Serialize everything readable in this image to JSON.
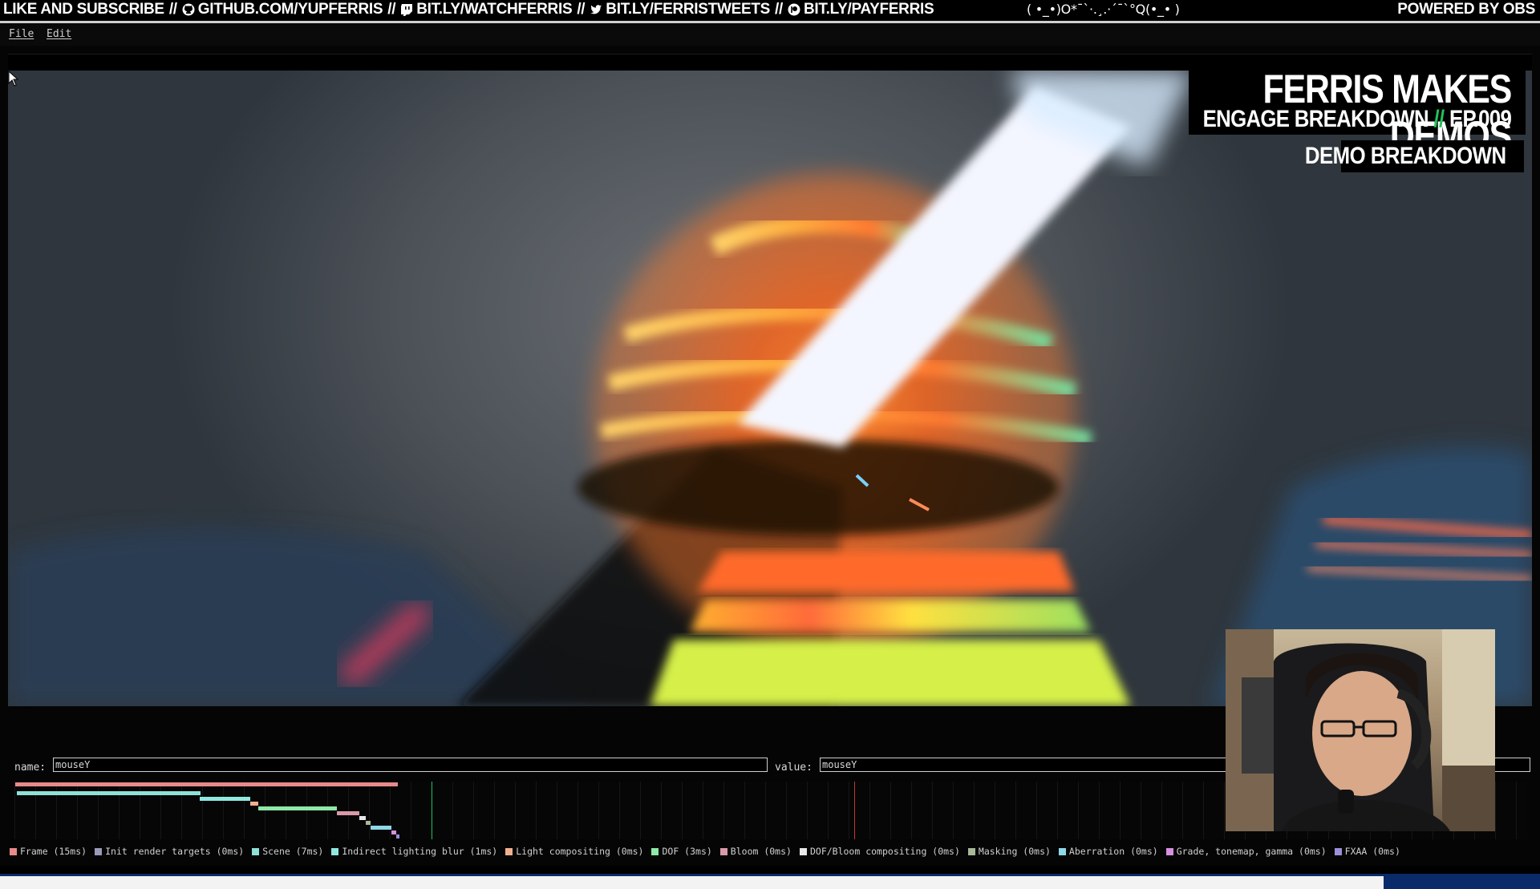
{
  "banner": {
    "items": [
      {
        "icon": "none",
        "text": "LIKE AND SUBSCRIBE"
      },
      {
        "icon": "github-icon",
        "text": "GITHUB.COM/YUPFERRIS"
      },
      {
        "icon": "twitch-icon",
        "text": "BIT.LY/WATCHFERRIS"
      },
      {
        "icon": "twitter-icon",
        "text": "BIT.LY/FERRISTWEETS"
      },
      {
        "icon": "patreon-icon",
        "text": "BIT.LY/PAYFERRIS"
      }
    ],
    "separator": "//",
    "kaomoji": "( •_•)O*¯`·.¸.·´¯`°Q(•_• )",
    "powered": "POWERED BY OBS"
  },
  "menu": {
    "file": "File",
    "edit": "Edit"
  },
  "overlay": {
    "title": "FERRIS MAKES DEMOS",
    "subtitle_left": "ENGAGE BREAKDOWN",
    "subtitle_sep": "//",
    "subtitle_right": "EP.009",
    "tag": "DEMO BREAKDOWN",
    "accent_color": "#21c25a"
  },
  "fields": {
    "name_label": "name:",
    "name_value": "mouseY",
    "value_label": "value:",
    "value_value": "mouseY"
  },
  "profiler": {
    "legend": [
      {
        "label": "Frame (15ms)",
        "color": "#e88a8a"
      },
      {
        "label": "Init render targets (0ms)",
        "color": "#9a9ab8"
      },
      {
        "label": "Scene (7ms)",
        "color": "#8fe0d8"
      },
      {
        "label": "Indirect lighting blur (1ms)",
        "color": "#8fe8e0"
      },
      {
        "label": "Light compositing (0ms)",
        "color": "#f0b090"
      },
      {
        "label": "DOF (3ms)",
        "color": "#8fe8a8"
      },
      {
        "label": "Bloom (0ms)",
        "color": "#d89aa8"
      },
      {
        "label": "DOF/Bloom compositing (0ms)",
        "color": "#e8e8e8"
      },
      {
        "label": "Masking (0ms)",
        "color": "#a8b898"
      },
      {
        "label": "Aberration (0ms)",
        "color": "#8fd8e8"
      },
      {
        "label": "Grade, tonemap, gamma (0ms)",
        "color": "#d890e0"
      },
      {
        "label": "FXAA (0ms)",
        "color": "#9a90d8"
      }
    ]
  }
}
